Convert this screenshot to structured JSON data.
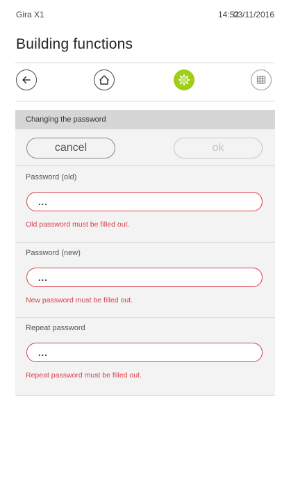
{
  "status": {
    "app_name": "Gira X1",
    "time": "14:52",
    "date": "03/11/2016"
  },
  "header": {
    "title": "Building functions"
  },
  "nav": {
    "items": [
      "back-icon",
      "home-icon",
      "settings-icon",
      "grid-icon"
    ],
    "active_color": "#9ccf16"
  },
  "form": {
    "section_title": "Changing the password",
    "cancel_label": "cancel",
    "ok_label": "ok",
    "fields": [
      {
        "label": "Password (old)",
        "value": "...",
        "error": "Old password must be filled out."
      },
      {
        "label": "Password (new)",
        "value": "...",
        "error": "New password must be filled out."
      },
      {
        "label": "Repeat password",
        "value": "...",
        "error": "Repeat password must be filled out."
      }
    ]
  },
  "colors": {
    "error": "#d8404a",
    "accent": "#9ccf16"
  }
}
